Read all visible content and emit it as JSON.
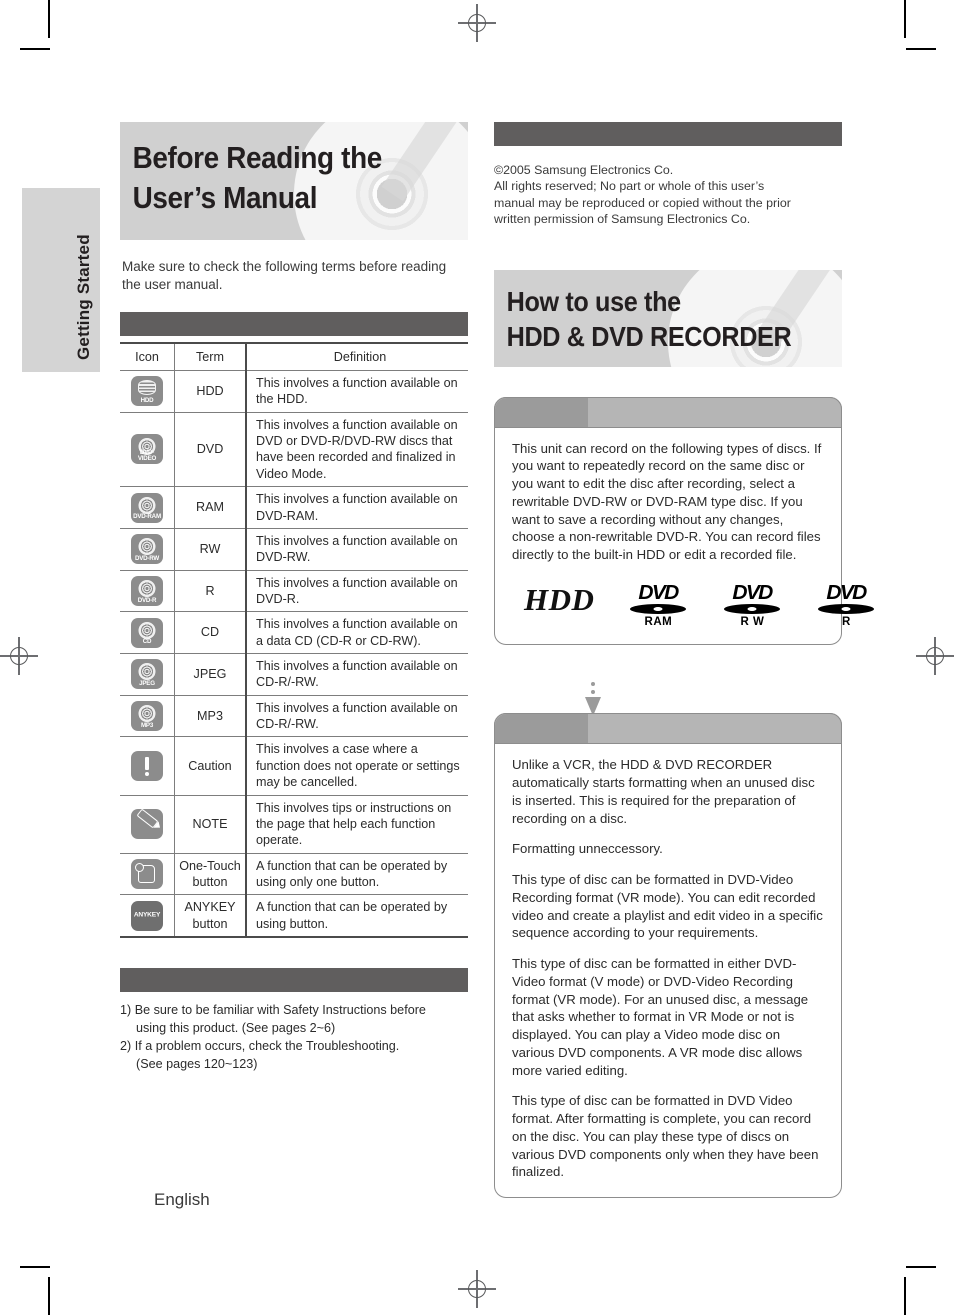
{
  "page": {
    "sidetab_label": "Getting Started",
    "footer_language": "English"
  },
  "left": {
    "title_line1": "Before Reading the",
    "title_line2": "User’s Manual",
    "intro": "Make sure to check the following terms before reading the user manual.",
    "table": {
      "headers": [
        "Icon",
        "Term",
        "Definition"
      ],
      "rows": [
        {
          "icon": "hdd-icon",
          "icon_caption": "HDD",
          "term": "HDD",
          "definition": "This involves a function available on the HDD."
        },
        {
          "icon": "dvd-video-icon",
          "icon_caption": "DVD-VIDEO",
          "term": "DVD",
          "definition": "This involves a function available on DVD or DVD-R/DVD-RW discs that have been recorded and finalized in Video Mode."
        },
        {
          "icon": "dvd-ram-icon",
          "icon_caption": "DVD-RAM",
          "term": "RAM",
          "definition": "This involves a function available on DVD-RAM."
        },
        {
          "icon": "dvd-rw-icon",
          "icon_caption": "DVD-RW",
          "term": "RW",
          "definition": "This involves a function available on DVD-RW."
        },
        {
          "icon": "dvd-r-icon",
          "icon_caption": "DVD-R",
          "term": "R",
          "definition": "This involves a function available on DVD-R."
        },
        {
          "icon": "cd-icon",
          "icon_caption": "CD",
          "term": "CD",
          "definition": "This involves a function available on a data CD (CD-R or CD-RW)."
        },
        {
          "icon": "jpeg-icon",
          "icon_caption": "JPEG",
          "term": "JPEG",
          "definition": "This involves a function available  on CD-R/-RW."
        },
        {
          "icon": "mp3-icon",
          "icon_caption": "MP3",
          "term": "MP3",
          "definition": "This involves a function available on CD-R/-RW."
        },
        {
          "icon": "caution-icon",
          "icon_caption": "",
          "term": "Caution",
          "definition": "This involves a case where a function does not operate or settings may be cancelled."
        },
        {
          "icon": "note-pencil-icon",
          "icon_caption": "",
          "term": "NOTE",
          "definition": "This involves tips or instructions on the page that help each function operate."
        },
        {
          "icon": "one-touch-icon",
          "icon_caption": "",
          "term": "One-Touch button",
          "definition": "A function that can be operated by using only one button."
        },
        {
          "icon": "anykey-icon",
          "icon_caption": "ANYKEY",
          "term": "ANYKEY button",
          "definition": "A function that can be operated by using                     button."
        }
      ]
    },
    "notes": {
      "item1": "1) Be sure to be familiar with Safety Instructions before",
      "item1_cont": "using this product. (See pages 2~6)",
      "item2": "2) If a problem occurs, check the Troubleshooting.",
      "item2_cont": "(See pages 120~123)"
    }
  },
  "right": {
    "copyright_line1": "©2005 Samsung Electronics Co.",
    "copyright_line2": "All rights reserved; No part or whole of this user’s",
    "copyright_line3": "manual may be reproduced or copied without the prior",
    "copyright_line4": "written permission of Samsung Electronics Co.",
    "title_line1": "How to use the",
    "title_line2": "HDD & DVD RECORDER",
    "step1": {
      "header_tag": "",
      "header_title": "",
      "body": "This unit can record on the following types of discs. If you want to repeatedly record on the same disc or you want to edit the disc after recording, select a rewritable DVD-RW or DVD-RAM type disc. If you want to save a recording without any changes, choose a non-rewritable DVD-R. You can record files directly to the built-in HDD or edit a recorded file.",
      "logos": [
        {
          "name": "HDD",
          "sub": ""
        },
        {
          "name": "DVD",
          "sub": "RAM"
        },
        {
          "name": "DVD",
          "sub": "R W"
        },
        {
          "name": "DVD",
          "sub": "R"
        }
      ]
    },
    "step2": {
      "header_tag": "",
      "header_title": "",
      "para1": "Unlike a VCR, the HDD & DVD RECORDER automatically starts formatting when an unused disc is inserted. This is required for the preparation of recording on a disc.",
      "para2": "Formatting unneccessory.",
      "para3": "This type of disc can be formatted in DVD-Video Recording format (VR mode). You can edit recorded video and create a playlist and edit video in a specific sequence according to your requirements.",
      "para4": "This type of disc can be formatted in either DVD-Video format (V mode) or DVD-Video Recording format (VR mode). For an unused disc, a message that asks whether to format in VR Mode or not is displayed. You can play a Video mode disc on various DVD components. A VR mode disc allows more varied editing.",
      "para5": "This type of disc can be formatted in DVD Video format. After formatting is complete, you can record on the disc. You can play these type of discs on various DVD components only when they have been finalized."
    }
  },
  "colors": {
    "banner_grey": "#d0d0d0",
    "dark_bar": "#605e5e",
    "icon_grey": "#8c8c8c",
    "step_head_light": "#b5b5b5",
    "step_head_dark": "#9b9b9b",
    "text": "#231f20"
  }
}
